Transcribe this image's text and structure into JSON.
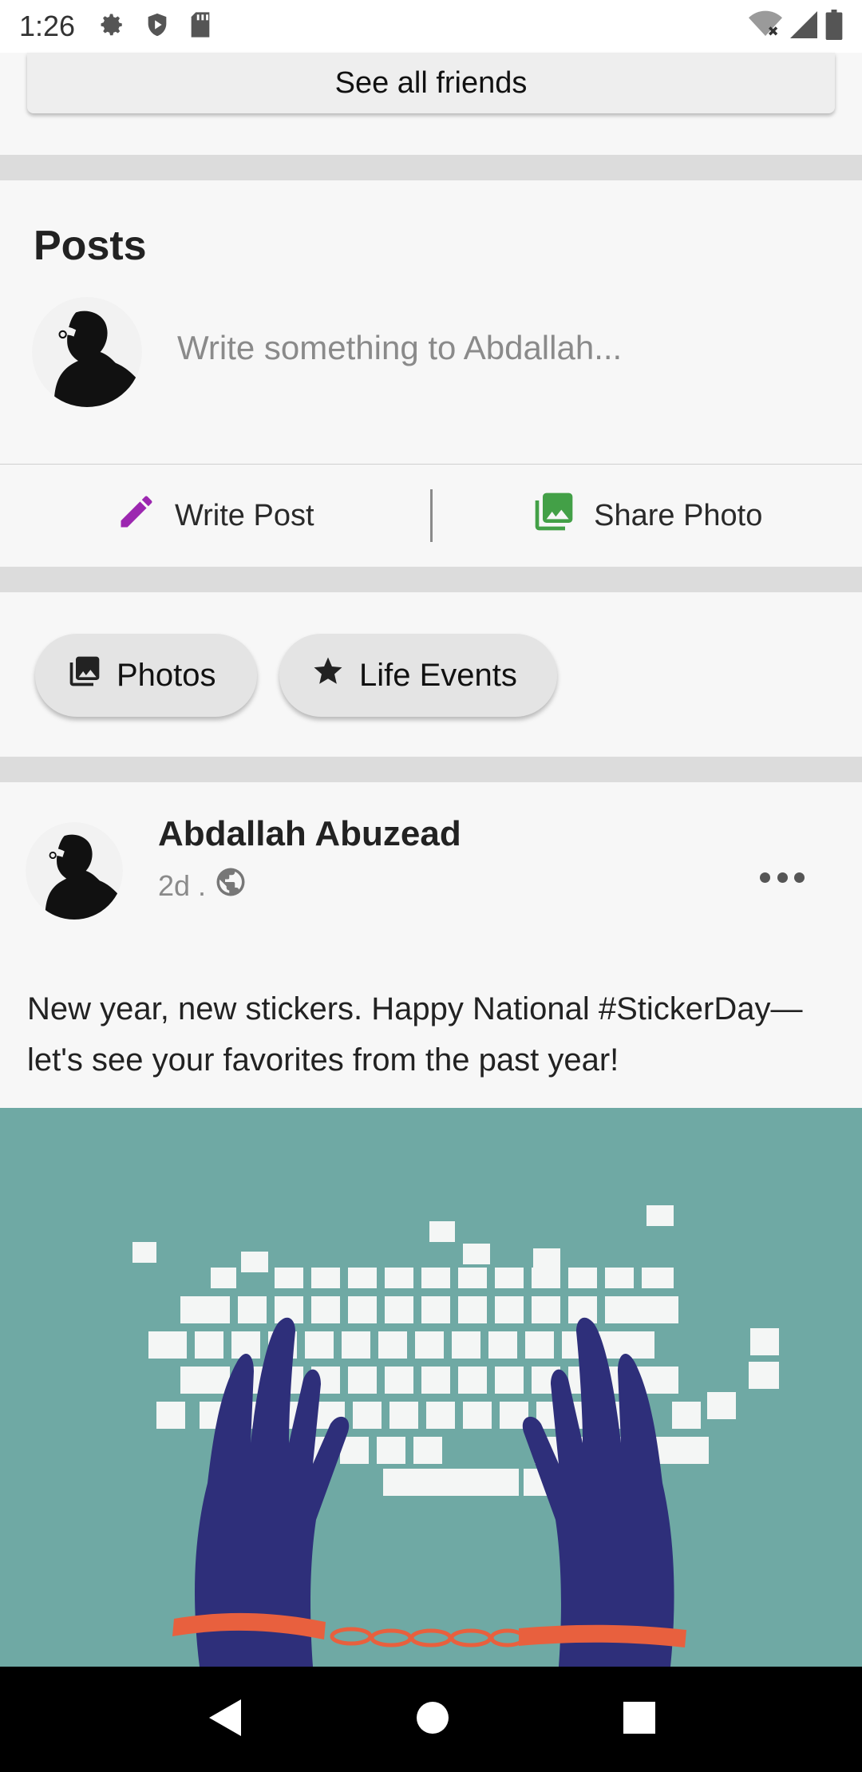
{
  "status_bar": {
    "time": "1:26",
    "icons_left": [
      "settings-icon",
      "shield-play-icon",
      "sd-card-icon"
    ],
    "icons_right": [
      "wifi-off-icon",
      "signal-icon",
      "battery-icon"
    ]
  },
  "friends": {
    "see_all_label": "See all friends"
  },
  "posts": {
    "title": "Posts",
    "composer_placeholder": "Write something to Abdallah...",
    "write_post_label": "Write Post",
    "share_photo_label": "Share Photo"
  },
  "chips": {
    "photos_label": "Photos",
    "life_events_label": "Life Events"
  },
  "post": {
    "author": "Abdallah Abuzead",
    "time": "2d .",
    "text": "New year, new stickers. Happy National #StickerDay—let's see your favorites from the past year!"
  },
  "colors": {
    "write_post_icon": "#9c27b0",
    "share_photo_icon": "#43a047",
    "image_bg": "#6fa9a4",
    "hands": "#2e2f7a",
    "cuffs": "#e8603e"
  }
}
